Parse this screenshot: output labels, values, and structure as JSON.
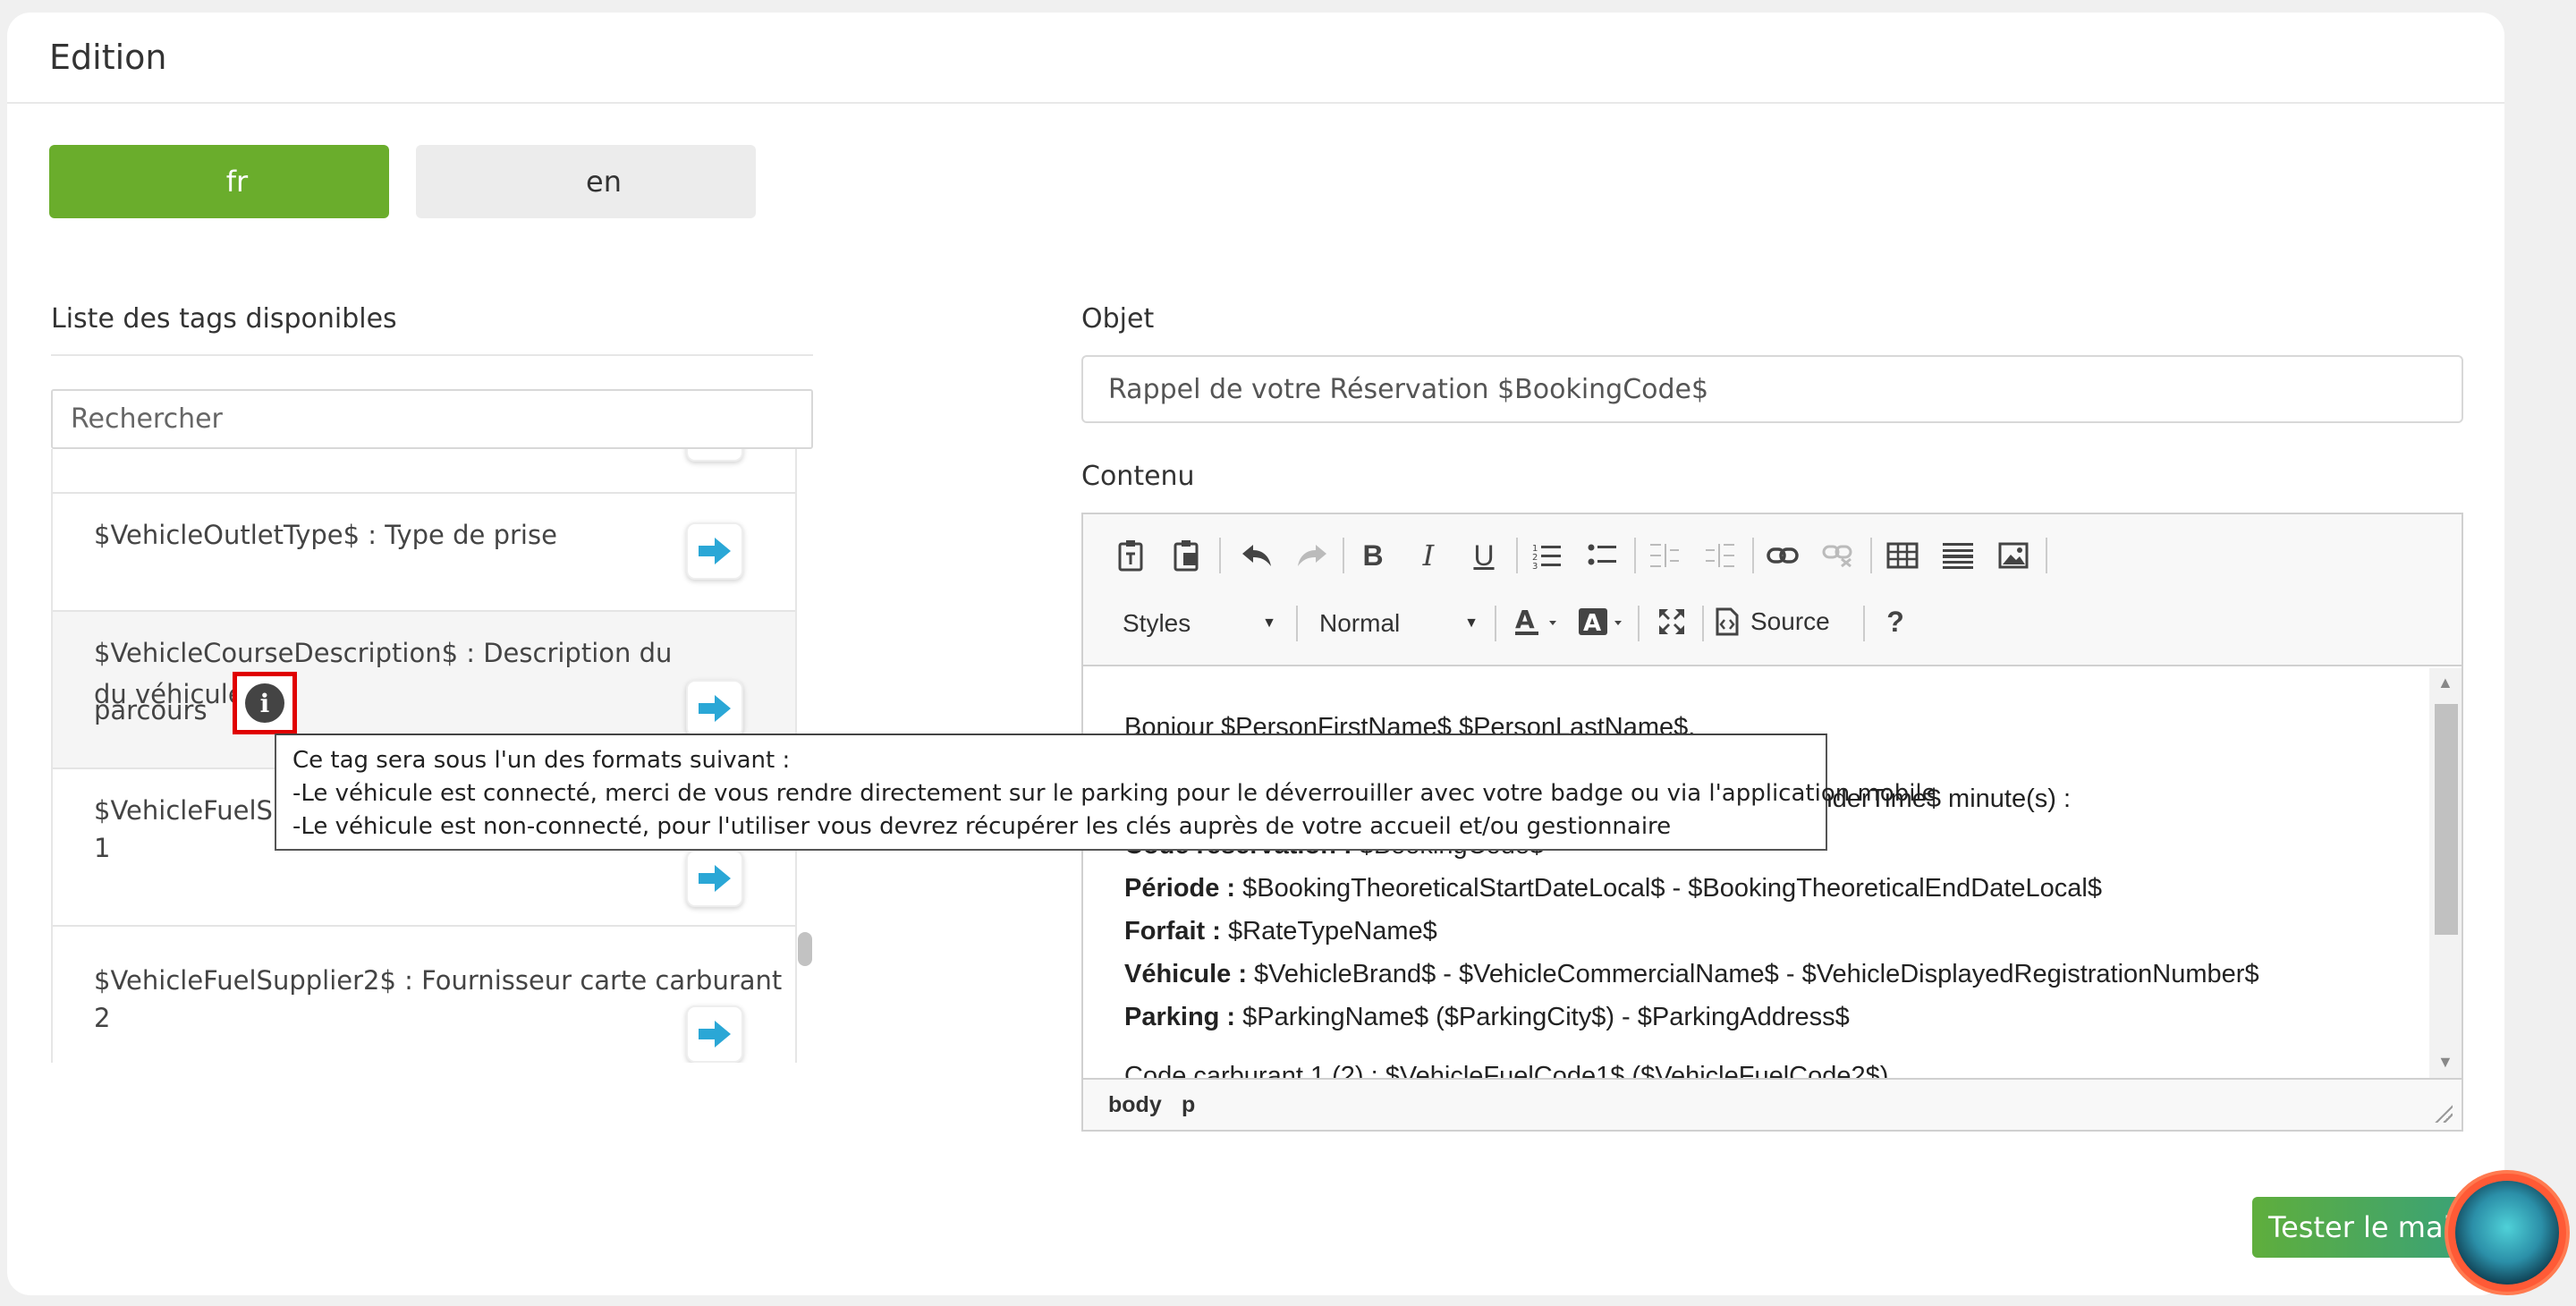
{
  "card": {
    "title": "Edition"
  },
  "languages": [
    {
      "code": "fr",
      "active": true
    },
    {
      "code": "en",
      "active": false
    }
  ],
  "tags_panel": {
    "heading": "Liste des tags disponibles",
    "search_placeholder": "Rechercher",
    "items": [
      {
        "text": "$VehicleOutletType$ : Type de prise"
      },
      {
        "line1": "$VehicleCourseDescription$ : Description du parcours",
        "line2": "du véhicule"
      },
      {
        "line1": "$VehicleFuelSu",
        "line2": "1"
      },
      {
        "line1": "$VehicleFuelSupplier2$ : Fournisseur carte carburant",
        "line2": "2"
      }
    ]
  },
  "tooltip": {
    "lines": [
      "Ce tag sera sous l'un des formats suivant :",
      "-Le véhicule est connecté, merci de vous rendre directement sur le parking pour le déverrouiller avec votre badge ou via l'application mobile",
      "-Le véhicule est non-connecté, pour l'utiliser vous devrez récupérer les clés auprès de votre accueil et/ou gestionnaire"
    ]
  },
  "object": {
    "label": "Objet",
    "value": "Rappel de votre Réservation $BookingCode$"
  },
  "content": {
    "label": "Contenu",
    "toolbar": {
      "styles_label": "Styles",
      "format_label": "Normal",
      "source_label": "Source",
      "help_label": "?"
    },
    "lines": {
      "greeting": "Bonjour $PersonFirstName$ $PersonLastName$,",
      "reminder_tail": "inderTime$ minute(s) :",
      "booking_code_label": "Code réservation :",
      "booking_code_value": " $BookingCode$",
      "period_label": "Période :",
      "period_value": " $BookingTheoreticalStartDateLocal$ - $BookingTheoreticalEndDateLocal$",
      "rate_label": "Forfait :",
      "rate_value": " $RateTypeName$",
      "vehicle_label": "Véhicule :",
      "vehicle_value": " $VehicleBrand$ - $VehicleCommercialName$ - $VehicleDisplayedRegistrationNumber$",
      "parking_label": "Parking :",
      "parking_value": " $ParkingName$ ($ParkingCity$) - $ParkingAddress$",
      "fuel_partial": "Code carburant 1 (2) : $VehicleFuelCode1$ ($VehicleFuelCode2$)"
    },
    "statusbar": {
      "crumb_body": "body",
      "crumb_p": "p"
    }
  },
  "actions": {
    "test_mail_label": "Tester le mail"
  },
  "colors": {
    "primary_green": "#6aad2c",
    "arrow_blue": "#2aa7d6",
    "highlight_red": "#e00000"
  }
}
